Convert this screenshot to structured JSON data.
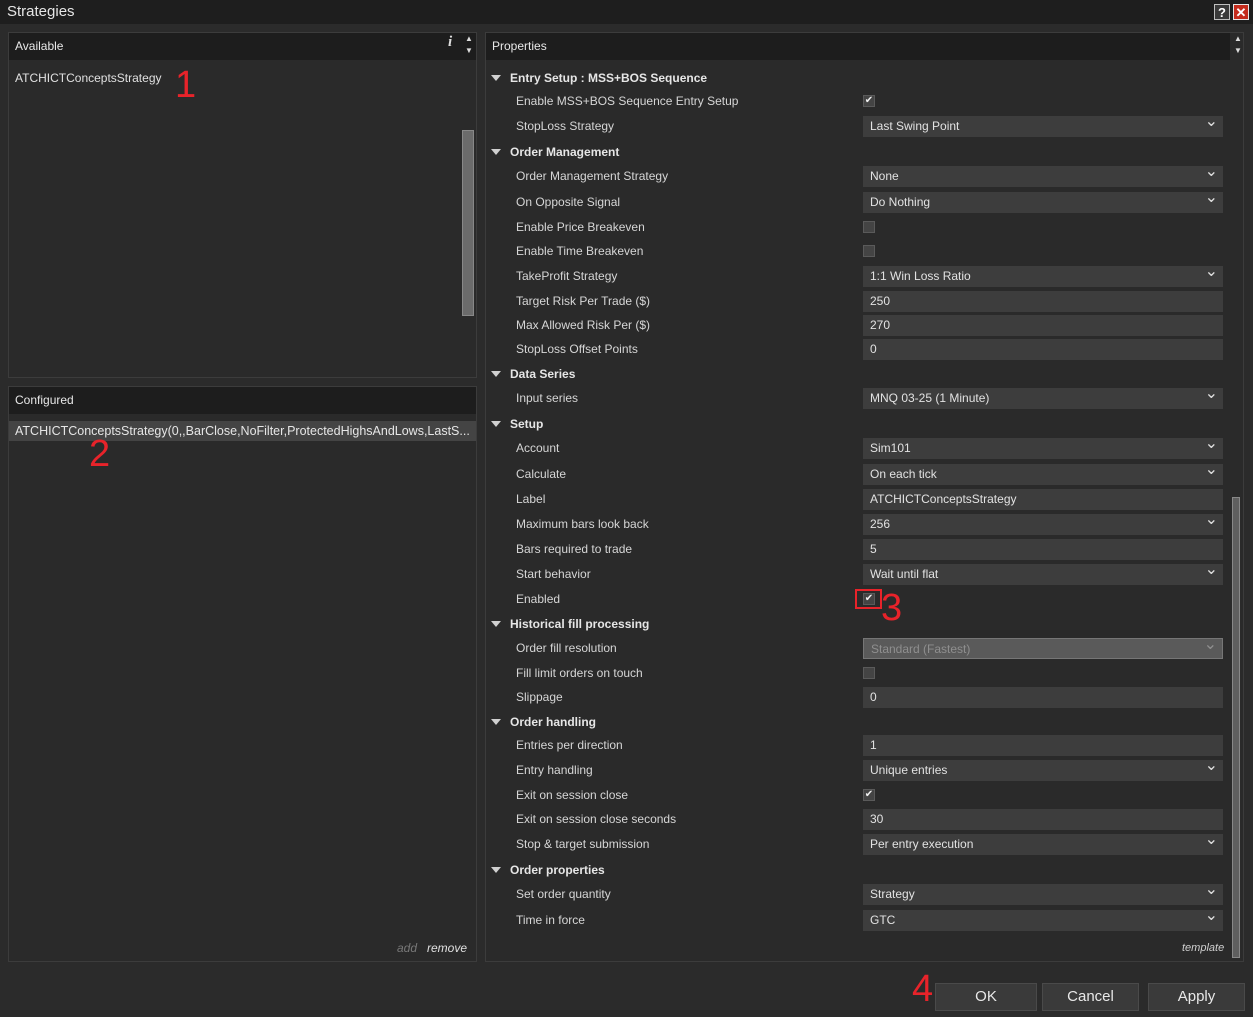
{
  "window": {
    "title": "Strategies",
    "help_label": "?",
    "close_label": "✕"
  },
  "available": {
    "header": "Available",
    "info_label": "i",
    "items": [
      "ATCHICTConceptsStrategy"
    ]
  },
  "configured": {
    "header": "Configured",
    "items": [
      "ATCHICTConceptsStrategy(0,,BarClose,NoFilter,ProtectedHighsAndLows,LastS..."
    ],
    "add_label": "add",
    "remove_label": "remove"
  },
  "properties": {
    "header": "Properties",
    "template_label": "template",
    "categories": [
      {
        "label": "Entry Setup : MSS+BOS Sequence"
      },
      {
        "label": "Order Management"
      },
      {
        "label": "Data Series"
      },
      {
        "label": "Setup"
      },
      {
        "label": "Historical fill processing"
      },
      {
        "label": "Order handling"
      },
      {
        "label": "Order properties"
      }
    ],
    "rows": [
      {
        "label": "Enable MSS+BOS Sequence Entry Setup",
        "type": "checkbox",
        "checked": true
      },
      {
        "label": "StopLoss Strategy",
        "type": "select",
        "value": "Last Swing Point"
      },
      {
        "label": "Order Management Strategy",
        "type": "select",
        "value": "None"
      },
      {
        "label": "On Opposite Signal",
        "type": "select",
        "value": "Do Nothing"
      },
      {
        "label": "Enable Price Breakeven",
        "type": "checkbox",
        "checked": false
      },
      {
        "label": "Enable Time Breakeven",
        "type": "checkbox",
        "checked": false
      },
      {
        "label": "TakeProfit Strategy",
        "type": "select",
        "value": "1:1 Win Loss Ratio"
      },
      {
        "label": "Target Risk Per Trade ($)",
        "type": "text",
        "value": "250"
      },
      {
        "label": "Max Allowed Risk Per ($)",
        "type": "text",
        "value": "270"
      },
      {
        "label": "StopLoss Offset Points",
        "type": "text",
        "value": "0"
      },
      {
        "label": "Input series",
        "type": "select",
        "value": "MNQ 03-25 (1 Minute)"
      },
      {
        "label": "Account",
        "type": "select",
        "value": "Sim101"
      },
      {
        "label": "Calculate",
        "type": "select",
        "value": "On each tick"
      },
      {
        "label": "Label",
        "type": "text",
        "value": "ATCHICTConceptsStrategy"
      },
      {
        "label": "Maximum bars look back",
        "type": "select",
        "value": "256"
      },
      {
        "label": "Bars required to trade",
        "type": "text",
        "value": "5"
      },
      {
        "label": "Start behavior",
        "type": "select",
        "value": "Wait until flat"
      },
      {
        "label": "Enabled",
        "type": "checkbox",
        "checked": true
      },
      {
        "label": "Order fill resolution",
        "type": "select",
        "value": "Standard (Fastest)",
        "disabled": true
      },
      {
        "label": "Fill limit orders on touch",
        "type": "checkbox",
        "checked": false
      },
      {
        "label": "Slippage",
        "type": "text",
        "value": "0"
      },
      {
        "label": "Entries per direction",
        "type": "text",
        "value": "1"
      },
      {
        "label": "Entry handling",
        "type": "select",
        "value": "Unique entries"
      },
      {
        "label": "Exit on session close",
        "type": "checkbox",
        "checked": true
      },
      {
        "label": "Exit on session close seconds",
        "type": "text",
        "value": "30"
      },
      {
        "label": "Stop & target submission",
        "type": "select",
        "value": "Per entry execution"
      },
      {
        "label": "Set order quantity",
        "type": "select",
        "value": "Strategy"
      },
      {
        "label": "Time in force",
        "type": "select",
        "value": "GTC"
      }
    ]
  },
  "buttons": {
    "ok": "OK",
    "cancel": "Cancel",
    "apply": "Apply"
  },
  "markers": [
    "1",
    "2",
    "3",
    "4"
  ],
  "icons": {
    "checkmark": "✔",
    "chevron": "chevron-down-icon",
    "collapse": "triangle-down-icon"
  },
  "colors": {
    "background": "#2b2b2b",
    "header": "#1d1d1d",
    "field": "#3d3d3d",
    "marker": "#e8232a",
    "close": "#c42b1c"
  }
}
